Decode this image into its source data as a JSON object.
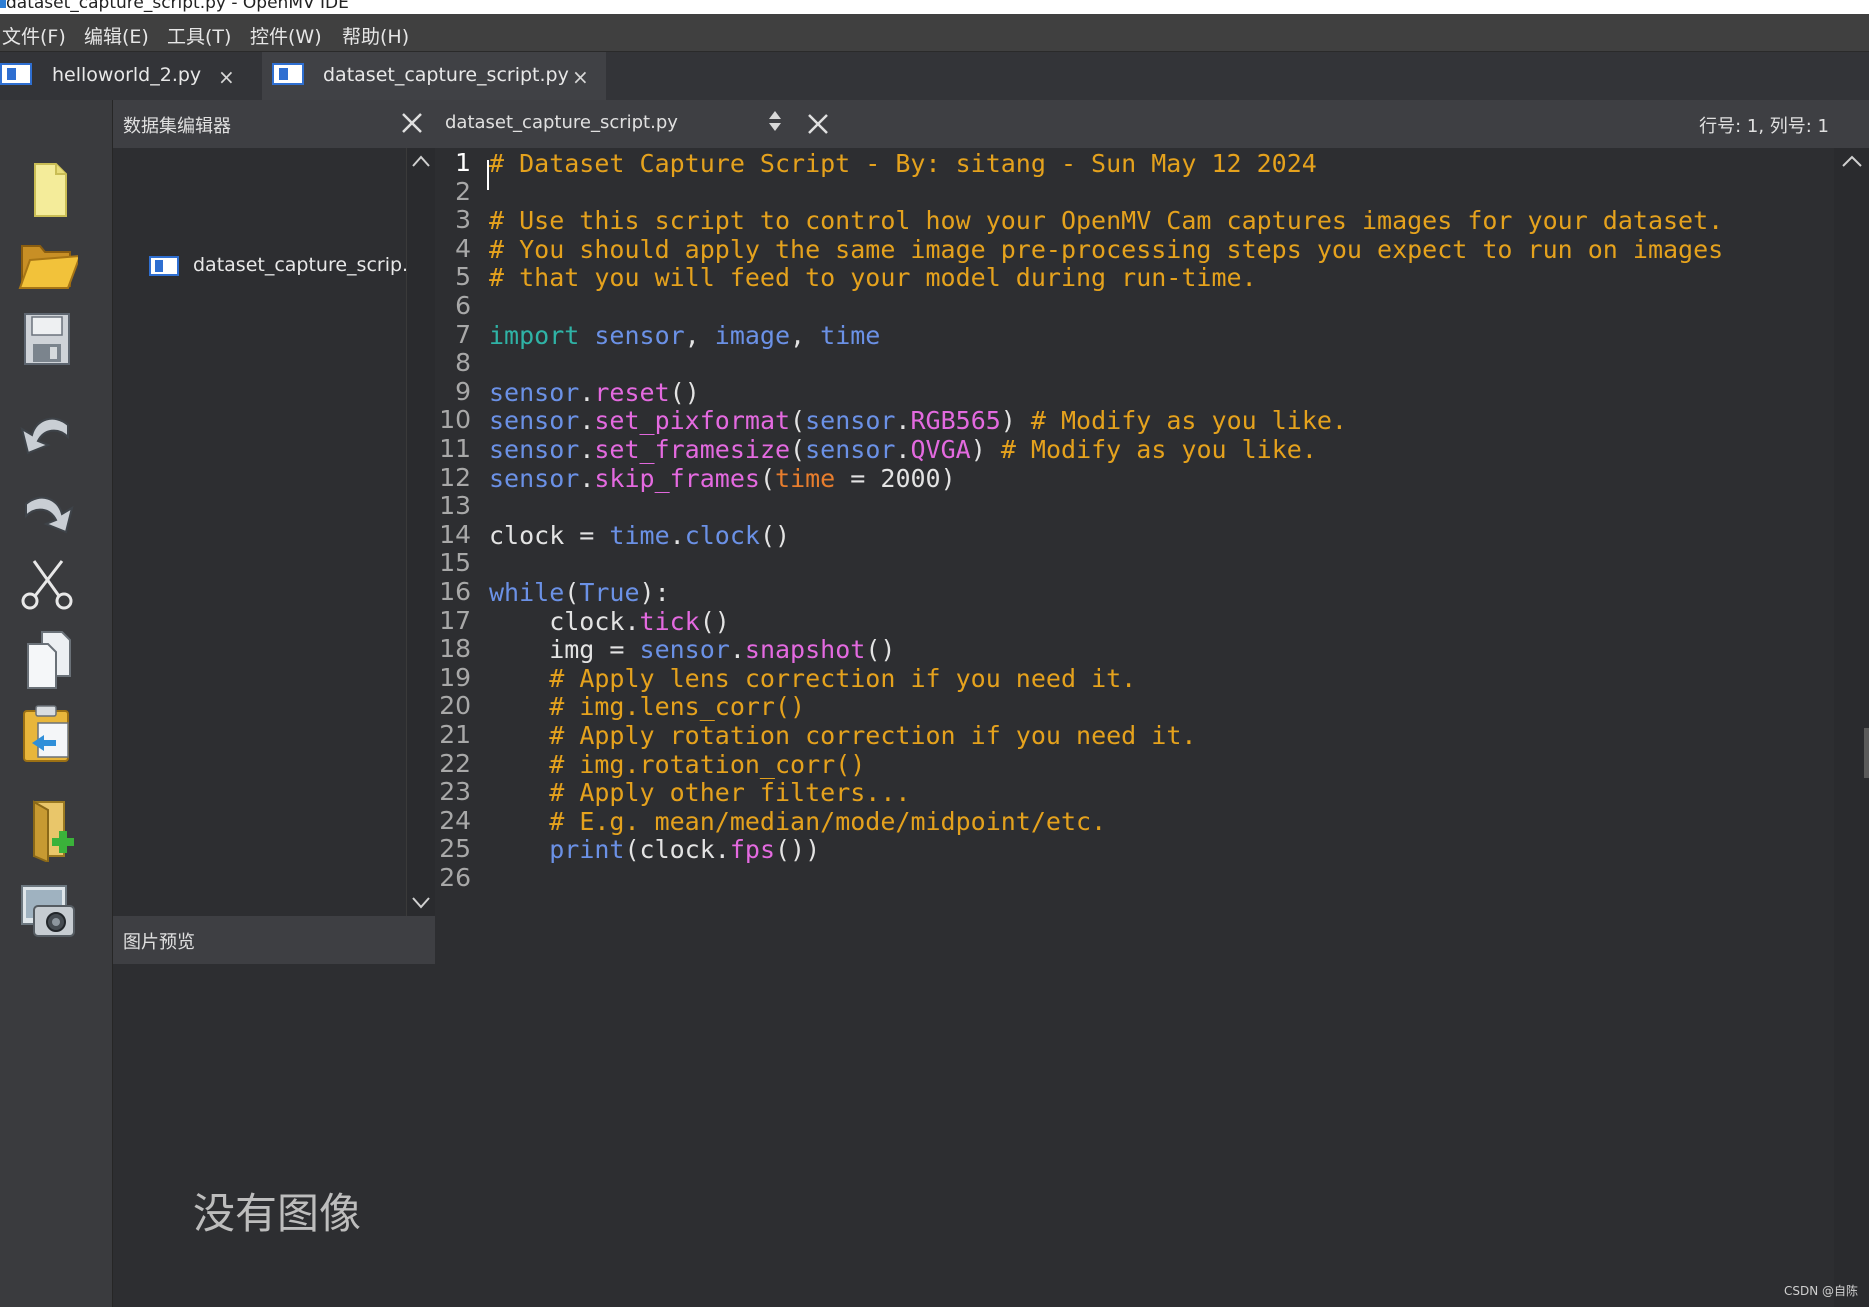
{
  "window": {
    "title": "dataset_capture_script.py - OpenMV IDE"
  },
  "menu": [
    "文件(F)",
    "编辑(E)",
    "工具(T)",
    "控件(W)",
    "帮助(H)"
  ],
  "file_tabs": [
    {
      "label": "helloworld_2.py",
      "close": "×",
      "active": false
    },
    {
      "label": "dataset_capture_script.py",
      "close": "×",
      "active": true
    }
  ],
  "toolbar_icons": [
    "new-file-icon",
    "open-folder-icon",
    "save-icon",
    "undo-icon",
    "redo-icon",
    "cut-icon",
    "copy-icon",
    "paste-icon",
    "new-dataset-icon",
    "capture-image-icon"
  ],
  "dataset_panel": {
    "title": "数据集编辑器",
    "items": [
      "dataset_capture_scrip..."
    ]
  },
  "preview_panel": {
    "title": "图片预览",
    "placeholder": "没有图像"
  },
  "editor": {
    "filename": "dataset_capture_script.py",
    "cursor_position": "行号: 1, 列号: 1",
    "lines": [
      [
        {
          "t": "# Dataset Capture Script - By: sitang - Sun May 12 2024",
          "c": "com"
        }
      ],
      [],
      [
        {
          "t": "# Use this script to control how your OpenMV Cam captures images for your dataset.",
          "c": "com"
        }
      ],
      [
        {
          "t": "# You should apply the same image pre-processing steps you expect to run on images",
          "c": "com"
        }
      ],
      [
        {
          "t": "# that you will feed to your model during run-time.",
          "c": "com"
        }
      ],
      [],
      [
        {
          "t": "import ",
          "c": "kw"
        },
        {
          "t": "sensor",
          "c": "mod"
        },
        {
          "t": ", ",
          "c": "txt"
        },
        {
          "t": "image",
          "c": "mod"
        },
        {
          "t": ", ",
          "c": "txt"
        },
        {
          "t": "time",
          "c": "mod"
        }
      ],
      [],
      [
        {
          "t": "sensor",
          "c": "mod"
        },
        {
          "t": ".",
          "c": "txt"
        },
        {
          "t": "reset",
          "c": "fn"
        },
        {
          "t": "()",
          "c": "txt"
        }
      ],
      [
        {
          "t": "sensor",
          "c": "mod"
        },
        {
          "t": ".",
          "c": "txt"
        },
        {
          "t": "set_pixformat",
          "c": "fn"
        },
        {
          "t": "(",
          "c": "txt"
        },
        {
          "t": "sensor",
          "c": "mod"
        },
        {
          "t": ".",
          "c": "txt"
        },
        {
          "t": "RGB565",
          "c": "fn"
        },
        {
          "t": ") ",
          "c": "txt"
        },
        {
          "t": "# Modify as you like.",
          "c": "com"
        }
      ],
      [
        {
          "t": "sensor",
          "c": "mod"
        },
        {
          "t": ".",
          "c": "txt"
        },
        {
          "t": "set_framesize",
          "c": "fn"
        },
        {
          "t": "(",
          "c": "txt"
        },
        {
          "t": "sensor",
          "c": "mod"
        },
        {
          "t": ".",
          "c": "txt"
        },
        {
          "t": "QVGA",
          "c": "fn"
        },
        {
          "t": ") ",
          "c": "txt"
        },
        {
          "t": "# Modify as you like.",
          "c": "com"
        }
      ],
      [
        {
          "t": "sensor",
          "c": "mod"
        },
        {
          "t": ".",
          "c": "txt"
        },
        {
          "t": "skip_frames",
          "c": "fn"
        },
        {
          "t": "(",
          "c": "txt"
        },
        {
          "t": "time",
          "c": "kwarg"
        },
        {
          "t": " = 2000)",
          "c": "txt"
        }
      ],
      [],
      [
        {
          "t": "clock = ",
          "c": "txt"
        },
        {
          "t": "time",
          "c": "mod"
        },
        {
          "t": ".",
          "c": "txt"
        },
        {
          "t": "clock",
          "c": "mod"
        },
        {
          "t": "()",
          "c": "txt"
        }
      ],
      [],
      [
        {
          "t": "while",
          "c": "mod"
        },
        {
          "t": "(",
          "c": "txt"
        },
        {
          "t": "True",
          "c": "mod"
        },
        {
          "t": "):",
          "c": "txt"
        }
      ],
      [
        {
          "t": "    clock.",
          "c": "txt"
        },
        {
          "t": "tick",
          "c": "fn"
        },
        {
          "t": "()",
          "c": "txt"
        }
      ],
      [
        {
          "t": "    img = ",
          "c": "txt"
        },
        {
          "t": "sensor",
          "c": "mod"
        },
        {
          "t": ".",
          "c": "txt"
        },
        {
          "t": "snapshot",
          "c": "fn"
        },
        {
          "t": "()",
          "c": "txt"
        }
      ],
      [
        {
          "t": "    ",
          "c": "txt"
        },
        {
          "t": "# Apply lens correction if you need it.",
          "c": "com"
        }
      ],
      [
        {
          "t": "    ",
          "c": "txt"
        },
        {
          "t": "# img.lens_corr()",
          "c": "com"
        }
      ],
      [
        {
          "t": "    ",
          "c": "txt"
        },
        {
          "t": "# Apply rotation correction if you need it.",
          "c": "com"
        }
      ],
      [
        {
          "t": "    ",
          "c": "txt"
        },
        {
          "t": "# img.rotation_corr()",
          "c": "com"
        }
      ],
      [
        {
          "t": "    ",
          "c": "txt"
        },
        {
          "t": "# Apply other filters...",
          "c": "com"
        }
      ],
      [
        {
          "t": "    ",
          "c": "txt"
        },
        {
          "t": "# E.g. mean/median/mode/midpoint/etc.",
          "c": "com"
        }
      ],
      [
        {
          "t": "    ",
          "c": "txt"
        },
        {
          "t": "print",
          "c": "mod"
        },
        {
          "t": "(clock.",
          "c": "txt"
        },
        {
          "t": "fps",
          "c": "fn"
        },
        {
          "t": "())",
          "c": "txt"
        }
      ],
      []
    ]
  },
  "watermark": "CSDN @自陈"
}
